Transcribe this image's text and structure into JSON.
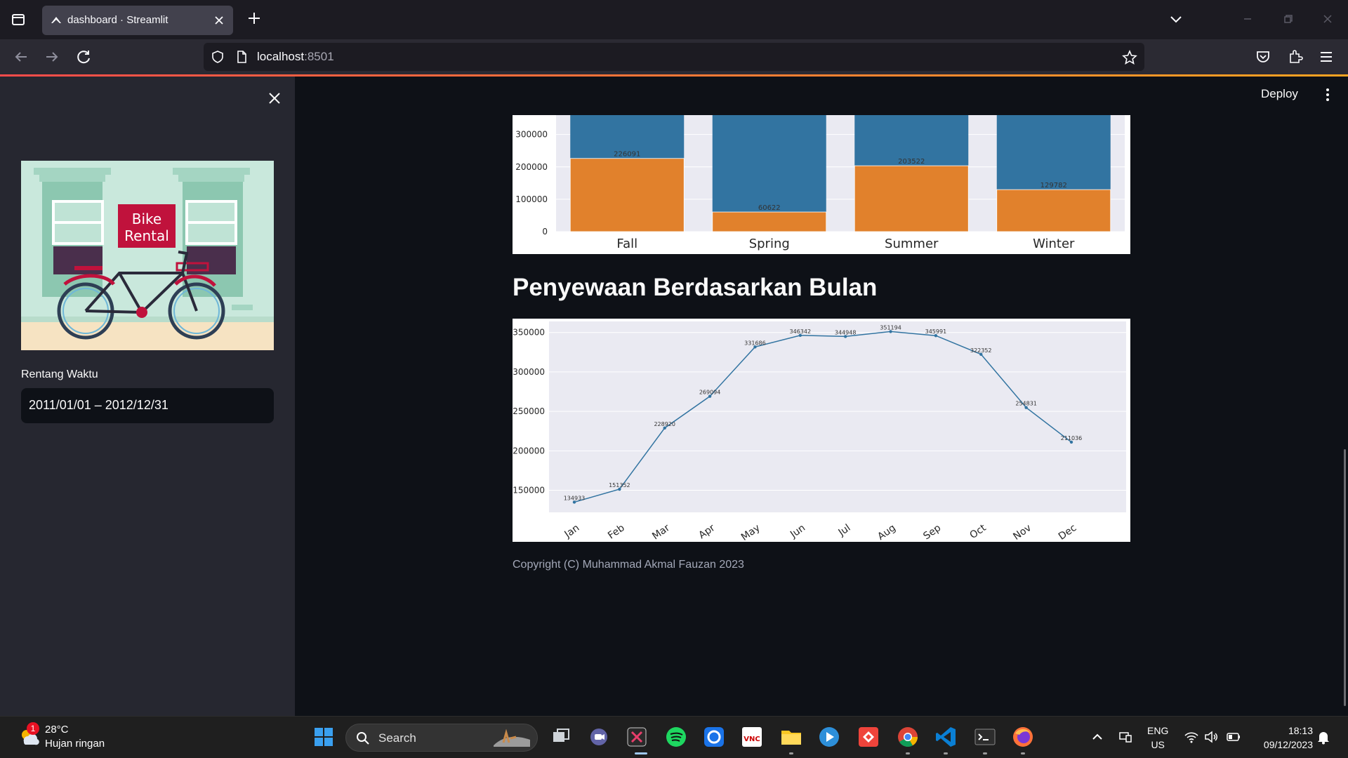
{
  "browser": {
    "tab_title": "dashboard · Streamlit",
    "url_host": "localhost",
    "url_port": ":8501"
  },
  "sidebar": {
    "hero_sign_line1": "Bike",
    "hero_sign_line2": "Rental",
    "range_label": "Rentang Waktu",
    "range_value": "2011/01/01 – 2012/12/31"
  },
  "header": {
    "deploy_label": "Deploy"
  },
  "main": {
    "month_section_title": "Penyewaan Berdasarkan Bulan",
    "copyright": "Copyright (C) Muhammad Akmal Fauzan 2023"
  },
  "chart_data": [
    {
      "type": "bar",
      "stacked": true,
      "categories": [
        "Fall",
        "Spring",
        "Summer",
        "Winter"
      ],
      "series": [
        {
          "values": [
            226091,
            60622,
            203522,
            129782
          ],
          "color": "#e1812c"
        },
        {
          "values": [
            null,
            null,
            null,
            null
          ],
          "color": "#3274a1"
        }
      ],
      "data_labels": [
        226091,
        60622,
        203522,
        129782
      ],
      "yticks": [
        0,
        100000,
        200000,
        300000
      ],
      "ylim": [
        0,
        360000
      ],
      "grid": true,
      "background": "#eaeaf2"
    },
    {
      "type": "line",
      "categories": [
        "Jan",
        "Feb",
        "Mar",
        "Apr",
        "May",
        "Jun",
        "Jul",
        "Aug",
        "Sep",
        "Oct",
        "Nov",
        "Dec"
      ],
      "values": [
        134933,
        151352,
        228920,
        269094,
        331686,
        346342,
        344948,
        351194,
        345991,
        322352,
        254831,
        211036
      ],
      "yticks": [
        150000,
        200000,
        250000,
        300000,
        350000
      ],
      "ylim": [
        122000,
        364000
      ],
      "color": "#3274a1",
      "background": "#eaeaf2"
    }
  ],
  "taskbar": {
    "weather_badge": "1",
    "temperature": "28°C",
    "weather_desc": "Hujan ringan",
    "search_label": "Search",
    "lang_line1": "ENG",
    "lang_line2": "US",
    "time": "18:13",
    "date": "09/12/2023"
  }
}
